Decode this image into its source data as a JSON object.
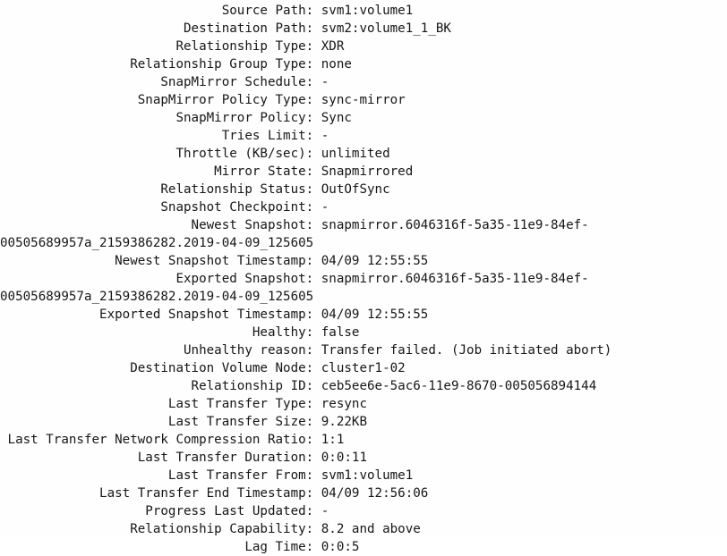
{
  "terminal": {
    "label_colon_column": 40,
    "value_column": 42,
    "colors": {
      "background": "#fefefe",
      "text": "#161616"
    }
  },
  "rows": [
    {
      "label": "Source Path",
      "value": "svm1:volume1",
      "continuation": null
    },
    {
      "label": "Destination Path",
      "value": "svm2:volume1_1_BK",
      "continuation": null
    },
    {
      "label": "Relationship Type",
      "value": "XDR",
      "continuation": null
    },
    {
      "label": "Relationship Group Type",
      "value": "none",
      "continuation": null
    },
    {
      "label": "SnapMirror Schedule",
      "value": "-",
      "continuation": null
    },
    {
      "label": "SnapMirror Policy Type",
      "value": "sync-mirror",
      "continuation": null
    },
    {
      "label": "SnapMirror Policy",
      "value": "Sync",
      "continuation": null
    },
    {
      "label": "Tries Limit",
      "value": "-",
      "continuation": null
    },
    {
      "label": "Throttle (KB/sec)",
      "value": "unlimited",
      "continuation": null
    },
    {
      "label": "Mirror State",
      "value": "Snapmirrored",
      "continuation": null
    },
    {
      "label": "Relationship Status",
      "value": "OutOfSync",
      "continuation": null
    },
    {
      "label": "Snapshot Checkpoint",
      "value": "-",
      "continuation": null
    },
    {
      "label": "Newest Snapshot",
      "value": "snapmirror.6046316f-5a35-11e9-84ef-",
      "continuation": "00505689957a_2159386282.2019-04-09_125605"
    },
    {
      "label": "Newest Snapshot Timestamp",
      "value": "04/09 12:55:55",
      "continuation": null
    },
    {
      "label": "Exported Snapshot",
      "value": "snapmirror.6046316f-5a35-11e9-84ef-",
      "continuation": "00505689957a_2159386282.2019-04-09_125605"
    },
    {
      "label": "Exported Snapshot Timestamp",
      "value": "04/09 12:55:55",
      "continuation": null
    },
    {
      "label": "Healthy",
      "value": "false",
      "continuation": null
    },
    {
      "label": "Unhealthy reason",
      "value": "Transfer failed. (Job initiated abort)",
      "continuation": null
    },
    {
      "label": "Destination Volume Node",
      "value": "cluster1-02",
      "continuation": null
    },
    {
      "label": "Relationship ID",
      "value": "ceb5ee6e-5ac6-11e9-8670-005056894144",
      "continuation": null
    },
    {
      "label": "Last Transfer Type",
      "value": "resync",
      "continuation": null
    },
    {
      "label": "Last Transfer Size",
      "value": "9.22KB",
      "continuation": null
    },
    {
      "label": "Last Transfer Network Compression Ratio",
      "value": "1:1",
      "continuation": null
    },
    {
      "label": "Last Transfer Duration",
      "value": "0:0:11",
      "continuation": null
    },
    {
      "label": "Last Transfer From",
      "value": "svm1:volume1",
      "continuation": null
    },
    {
      "label": "Last Transfer End Timestamp",
      "value": "04/09 12:56:06",
      "continuation": null
    },
    {
      "label": "Progress Last Updated",
      "value": "-",
      "continuation": null
    },
    {
      "label": "Relationship Capability",
      "value": "8.2 and above",
      "continuation": null
    },
    {
      "label": "Lag Time",
      "value": "0:0:5",
      "continuation": null
    }
  ]
}
